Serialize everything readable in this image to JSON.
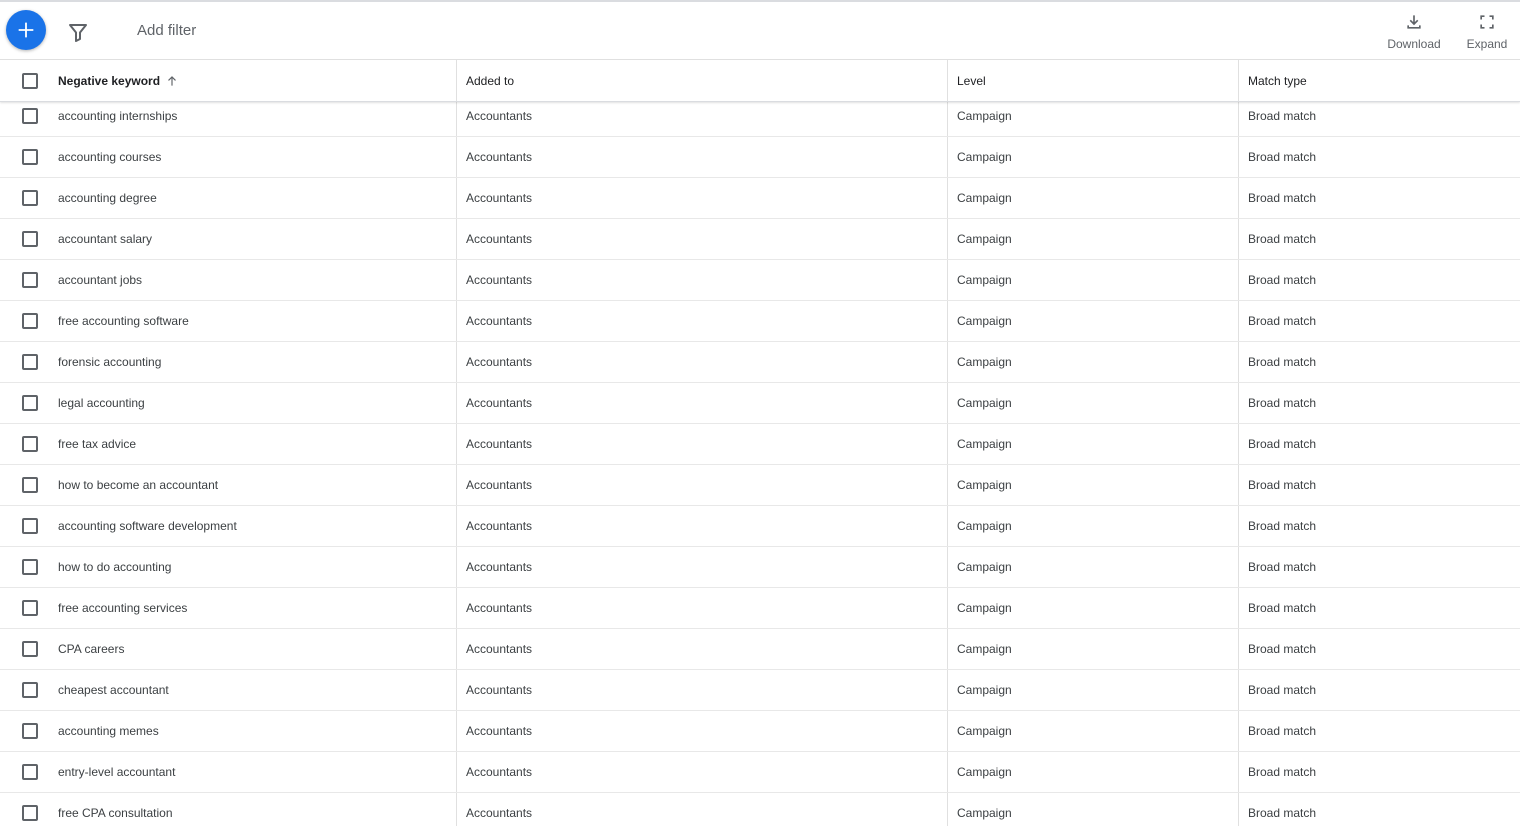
{
  "toolbar": {
    "add_filter_placeholder": "Add filter",
    "download_label": "Download",
    "expand_label": "Expand"
  },
  "colors": {
    "accent": "#1a73e8",
    "text": "#3c4043",
    "divider": "#e0e0e0"
  },
  "table": {
    "columns": {
      "keyword": "Negative keyword",
      "added_to": "Added to",
      "level": "Level",
      "match_type": "Match type"
    },
    "sort": {
      "column": "keyword",
      "direction": "ascending"
    },
    "rows": [
      {
        "keyword": "accounting internships",
        "added_to": "Accountants",
        "level": "Campaign",
        "match_type": "Broad match"
      },
      {
        "keyword": "accounting courses",
        "added_to": "Accountants",
        "level": "Campaign",
        "match_type": "Broad match"
      },
      {
        "keyword": "accounting degree",
        "added_to": "Accountants",
        "level": "Campaign",
        "match_type": "Broad match"
      },
      {
        "keyword": "accountant salary",
        "added_to": "Accountants",
        "level": "Campaign",
        "match_type": "Broad match"
      },
      {
        "keyword": "accountant jobs",
        "added_to": "Accountants",
        "level": "Campaign",
        "match_type": "Broad match"
      },
      {
        "keyword": "free accounting software",
        "added_to": "Accountants",
        "level": "Campaign",
        "match_type": "Broad match"
      },
      {
        "keyword": "forensic accounting",
        "added_to": "Accountants",
        "level": "Campaign",
        "match_type": "Broad match"
      },
      {
        "keyword": "legal accounting",
        "added_to": "Accountants",
        "level": "Campaign",
        "match_type": "Broad match"
      },
      {
        "keyword": "free tax advice",
        "added_to": "Accountants",
        "level": "Campaign",
        "match_type": "Broad match"
      },
      {
        "keyword": "how to become an accountant",
        "added_to": "Accountants",
        "level": "Campaign",
        "match_type": "Broad match"
      },
      {
        "keyword": "accounting software development",
        "added_to": "Accountants",
        "level": "Campaign",
        "match_type": "Broad match"
      },
      {
        "keyword": "how to do accounting",
        "added_to": "Accountants",
        "level": "Campaign",
        "match_type": "Broad match"
      },
      {
        "keyword": "free accounting services",
        "added_to": "Accountants",
        "level": "Campaign",
        "match_type": "Broad match"
      },
      {
        "keyword": "CPA careers",
        "added_to": "Accountants",
        "level": "Campaign",
        "match_type": "Broad match"
      },
      {
        "keyword": "cheapest accountant",
        "added_to": "Accountants",
        "level": "Campaign",
        "match_type": "Broad match"
      },
      {
        "keyword": "accounting memes",
        "added_to": "Accountants",
        "level": "Campaign",
        "match_type": "Broad match"
      },
      {
        "keyword": "entry-level accountant",
        "added_to": "Accountants",
        "level": "Campaign",
        "match_type": "Broad match"
      },
      {
        "keyword": "free CPA consultation",
        "added_to": "Accountants",
        "level": "Campaign",
        "match_type": "Broad match"
      }
    ]
  }
}
